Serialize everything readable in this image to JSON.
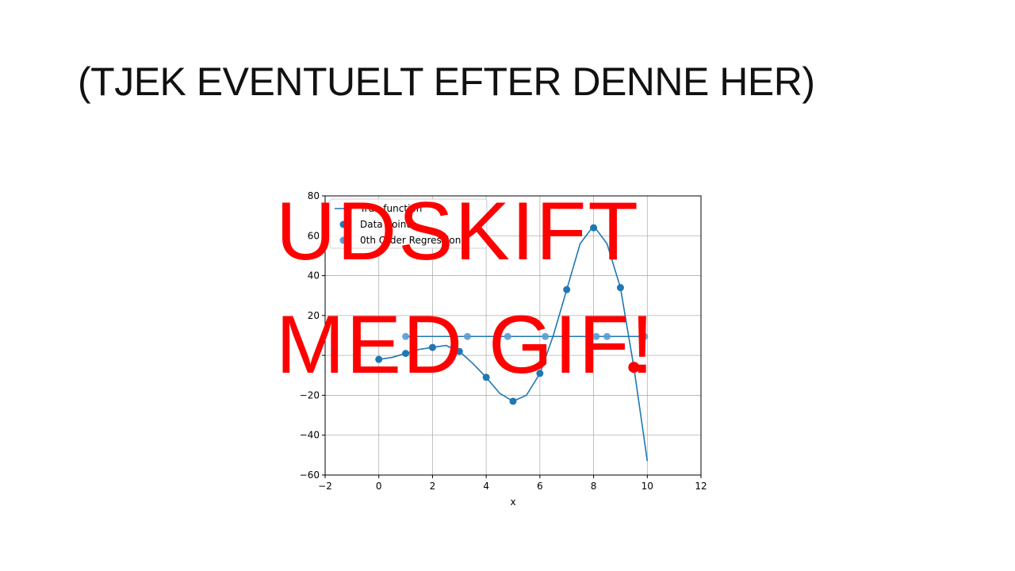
{
  "slide": {
    "title": "(TJEK EVENTUELT EFTER DENNE HER)",
    "overlay_line1": "UDSKIFT",
    "overlay_line2": "MED GIF!"
  },
  "colors": {
    "series": "#1f77b4",
    "regression": "#5b9bd5",
    "overlay": "#ff0000",
    "highlight_point": "#ff0000"
  },
  "chart_data": {
    "type": "scatter",
    "title": "",
    "xlabel": "x",
    "ylabel": "",
    "xlim": [
      -2,
      12
    ],
    "ylim": [
      -60,
      80
    ],
    "xticks": [
      -2,
      0,
      2,
      4,
      6,
      8,
      10,
      12
    ],
    "yticks": [
      -60,
      -40,
      -20,
      0,
      20,
      40,
      60,
      80
    ],
    "xtick_labels": [
      "−2",
      "0",
      "2",
      "4",
      "6",
      "8",
      "10",
      "12"
    ],
    "ytick_labels": [
      "−60",
      "−40",
      "−20",
      "0",
      "20",
      "40",
      "60",
      "80"
    ],
    "grid": true,
    "legend_position": "top-left",
    "series": [
      {
        "name": "True function",
        "kind": "line",
        "x": [
          0,
          0.5,
          1,
          1.5,
          2,
          2.5,
          3,
          3.5,
          4,
          4.5,
          5,
          5.5,
          6,
          6.5,
          7,
          7.5,
          8,
          8.5,
          9,
          9.5,
          10
        ],
        "y": [
          -2,
          -1,
          1,
          3,
          4,
          5,
          2,
          -4,
          -11,
          -19,
          -23,
          -20,
          -9,
          10,
          33,
          56,
          65,
          56,
          34,
          -6,
          -53
        ]
      },
      {
        "name": "Data points",
        "kind": "scatter",
        "x": [
          0,
          1,
          2,
          3,
          4,
          5,
          6,
          7,
          8,
          9,
          9.5
        ],
        "y": [
          -2,
          1,
          4,
          2,
          -11,
          -23,
          -9,
          33,
          64,
          34,
          -6
        ]
      },
      {
        "name": "0th Order Regression",
        "kind": "scatter-line",
        "level": 9.5,
        "x": [
          1,
          2.8,
          3.3,
          4.8,
          6.2,
          7.9,
          8.1,
          8.5,
          9.8,
          9.9
        ],
        "y": [
          9.5,
          9.5,
          9.5,
          9.5,
          9.5,
          9.5,
          9.5,
          9.5,
          9.5,
          9.5
        ]
      }
    ],
    "highlight": {
      "x": 9.5,
      "y": -6
    }
  }
}
